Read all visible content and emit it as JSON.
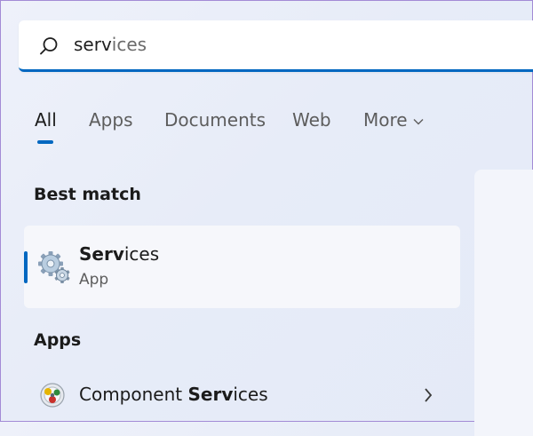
{
  "search": {
    "typed": "serv",
    "suggestion": "ices"
  },
  "tabs": [
    {
      "label": "All",
      "active": true
    },
    {
      "label": "Apps"
    },
    {
      "label": "Documents"
    },
    {
      "label": "Web"
    },
    {
      "label": "More"
    }
  ],
  "best_match": {
    "heading": "Best match",
    "title_bold": "Serv",
    "title_rest": "ices",
    "subtitle": "App",
    "icon": "gears-icon"
  },
  "apps": {
    "heading": "Apps",
    "items": [
      {
        "label_plain": "Component ",
        "label_bold": "Serv",
        "label_rest": "ices",
        "icon": "component-services-icon"
      }
    ]
  },
  "colors": {
    "accent": "#0067c0",
    "window_border": "#a38bd6"
  }
}
